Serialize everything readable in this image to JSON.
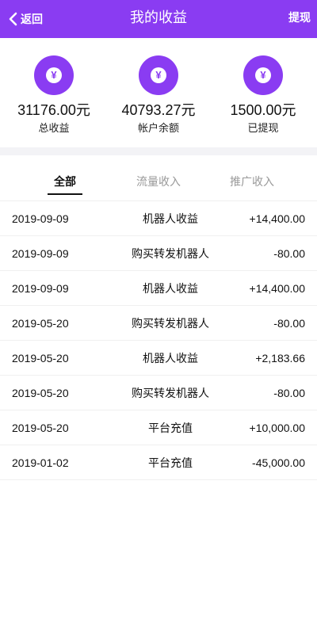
{
  "header": {
    "back_label": "返回",
    "title": "我的收益",
    "action_label": "提现",
    "bg_color": "#8a3cf2"
  },
  "stats": [
    {
      "amount": "31176.00元",
      "label": "总收益",
      "icon": "yen-coin-icon",
      "symbol": "¥"
    },
    {
      "amount": "40793.27元",
      "label": "帐户余额",
      "icon": "yen-coin-icon",
      "symbol": "¥"
    },
    {
      "amount": "1500.00元",
      "label": "已提现",
      "icon": "yen-coin-icon",
      "symbol": "¥"
    }
  ],
  "tabs": [
    {
      "label": "全部",
      "active": true
    },
    {
      "label": "流量收入",
      "active": false
    },
    {
      "label": "推广收入",
      "active": false
    }
  ],
  "records": [
    {
      "date": "2019-09-09",
      "desc": "机器人收益",
      "amount": "+14,400.00"
    },
    {
      "date": "2019-09-09",
      "desc": "购买转发机器人",
      "amount": "-80.00"
    },
    {
      "date": "2019-09-09",
      "desc": "机器人收益",
      "amount": "+14,400.00"
    },
    {
      "date": "2019-05-20",
      "desc": "购买转发机器人",
      "amount": "-80.00"
    },
    {
      "date": "2019-05-20",
      "desc": "机器人收益",
      "amount": "+2,183.66"
    },
    {
      "date": "2019-05-20",
      "desc": "购买转发机器人",
      "amount": "-80.00"
    },
    {
      "date": "2019-05-20",
      "desc": "平台充值",
      "amount": "+10,000.00"
    },
    {
      "date": "2019-01-02",
      "desc": "平台充值",
      "amount": "-45,000.00"
    }
  ]
}
